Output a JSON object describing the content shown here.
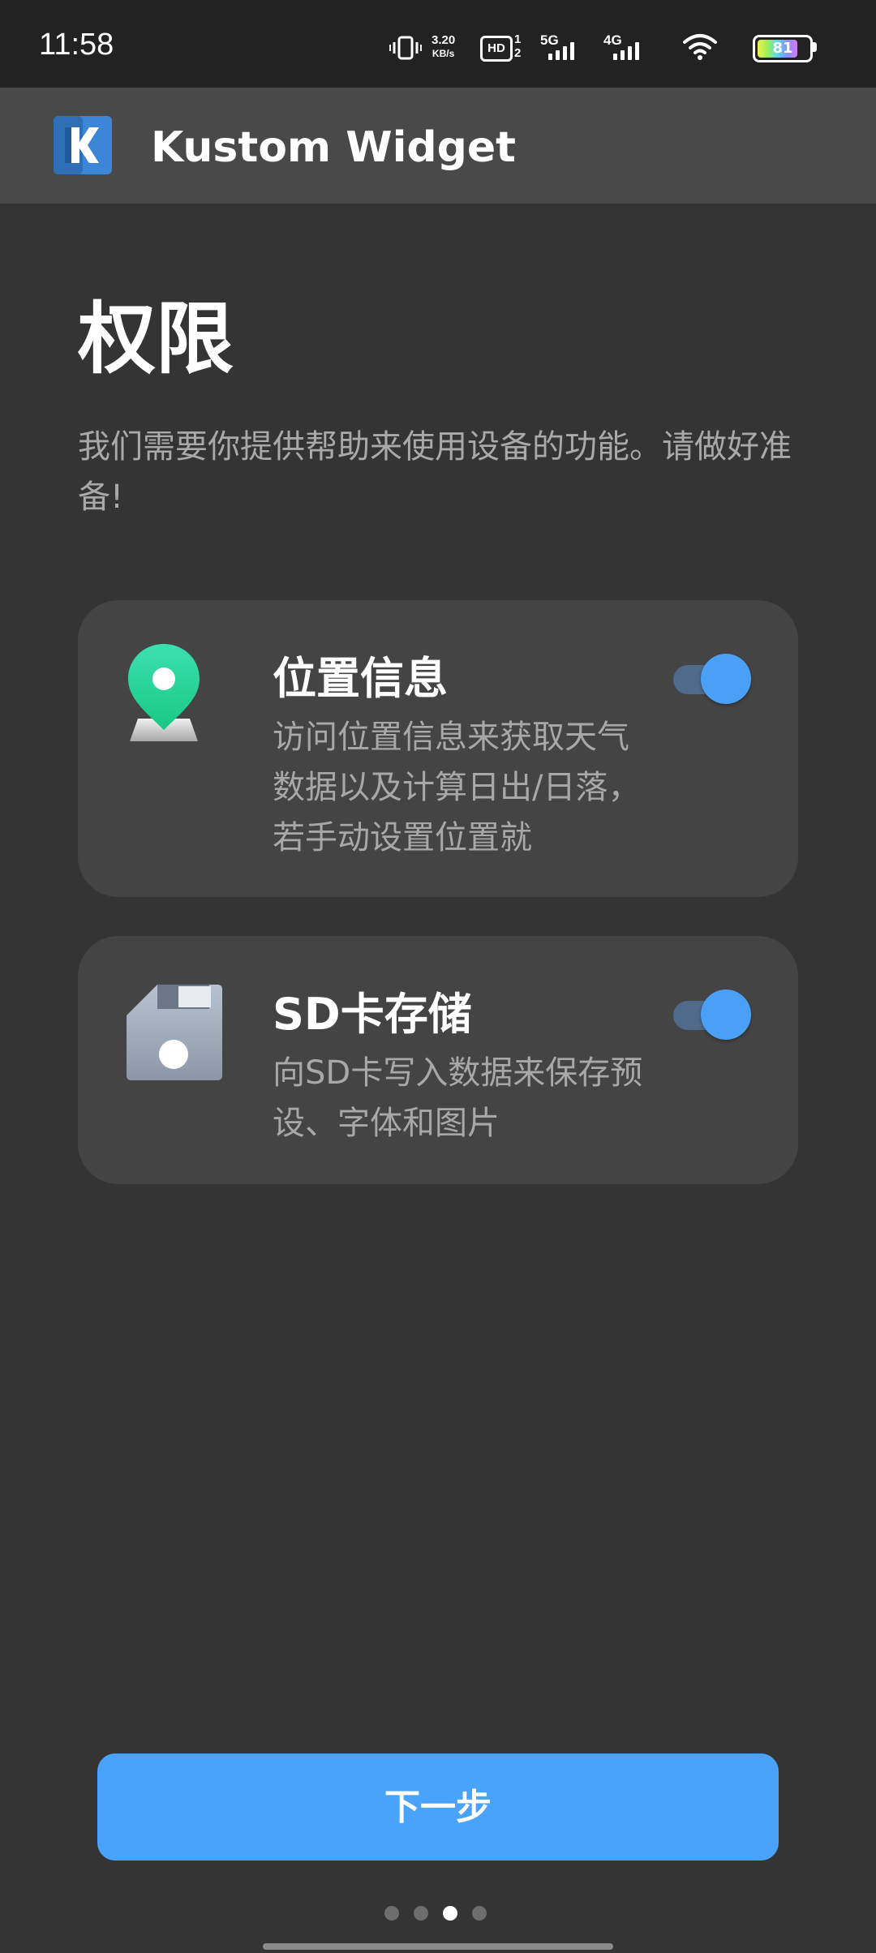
{
  "status_bar": {
    "time": "11:58",
    "net_speed_value": "3.20",
    "net_speed_unit": "KB/s",
    "hd_label": "HD",
    "sim1_label": "1",
    "sim2_label": "2",
    "signal1_label": "5G",
    "signal2_label": "4G",
    "battery_level": "81",
    "battery_fraction": 0.81
  },
  "app_bar": {
    "title": "Kustom Widget",
    "logo_icon": "kustom-k-logo"
  },
  "main": {
    "title": "权限",
    "description": "我们需要你提供帮助来使用设备的功能。请做好准备!"
  },
  "permissions": [
    {
      "icon": "location-pin-icon",
      "title": "位置信息",
      "description": "访问位置信息来获取天气数据以及计算日出/日落，若手动设置位置就",
      "enabled": true
    },
    {
      "icon": "floppy-disk-icon",
      "title": "SD卡存储",
      "description": "向SD卡写入数据来保存预设、字体和图片",
      "enabled": true
    }
  ],
  "footer": {
    "next_label": "下一步",
    "page_count": 4,
    "active_page": 3
  },
  "colors": {
    "background": "#343434",
    "status_bar": "#222222",
    "app_bar": "#494949",
    "card": "#444444",
    "accent": "#4aa3fb",
    "toggle_track": "#4f6a8a",
    "secondary_text": "#a8a8a8"
  }
}
